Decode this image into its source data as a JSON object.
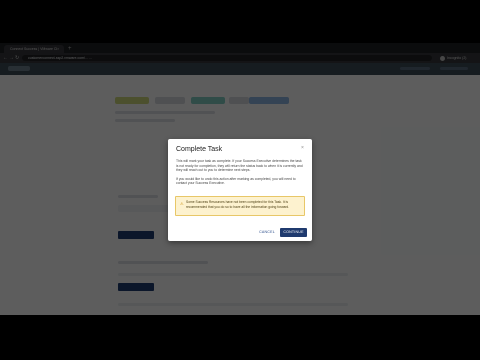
{
  "browser": {
    "tab_title": "Connect Success | VMware Cl",
    "tab_close": "×",
    "new_tab": "+",
    "back": "←",
    "forward": "→",
    "reload": "↻",
    "url": "customerconnect-ssp2.vmware.com/……",
    "profile": "Incognito (2)"
  },
  "modal": {
    "title": "Complete Task",
    "close": "×",
    "paragraph1": "This will mark your task as complete. If your Success Executive determines the task is not ready for completion, they will return the status back to when it is currently and they will reach out to you to determine next steps.",
    "paragraph2": "If you would like to undo this action after marking as completed, you will need to contact your Success Executive.",
    "warning": "Some Success Resources have not been completed for this Task. It is recommended that you do so to have all the information going forward.",
    "warning_icon": "warning-icon",
    "cancel_label": "CANCEL",
    "continue_label": "CONTINUE"
  },
  "colors": {
    "primary": "#1f3a6e",
    "warning_bg": "#fdf2cf",
    "overlay": "rgba(0,0,0,0.62)"
  }
}
